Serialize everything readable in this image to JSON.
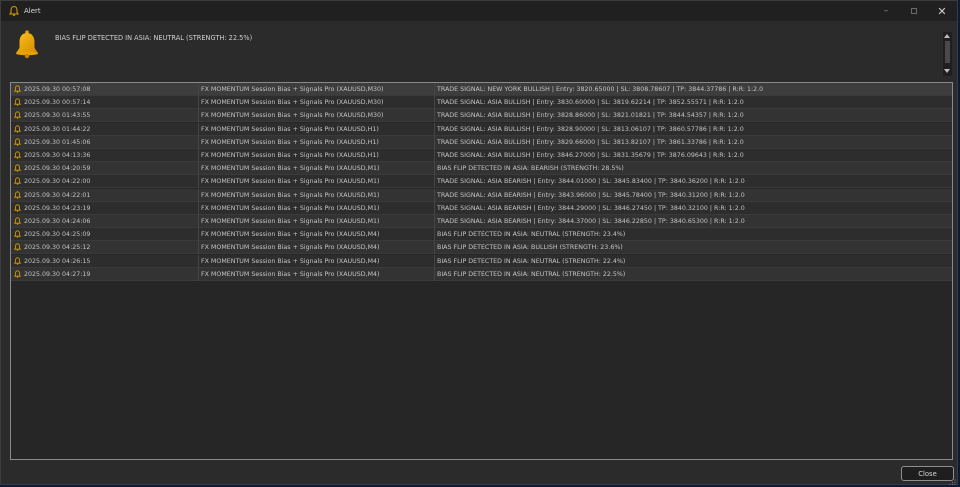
{
  "window": {
    "title": "Alert",
    "minimize_glyph": "–",
    "close_glyph": "✕"
  },
  "current_alert": {
    "icon": "bell-icon",
    "message": "BIAS FLIP DETECTED IN ASIA: NEUTRAL (STRENGTH: 22.5%)"
  },
  "colors": {
    "bell": "#e9a400",
    "row_bell_stroke": "#e0a000",
    "background": "#2b2b2b",
    "titlebar": "#202020"
  },
  "alerts": [
    {
      "time": "2025.09.30 00:57:08",
      "source": "FX MOMENTUM Session Bias + Signals Pro (XAUUSD,M30)",
      "message": "TRADE SIGNAL: NEW YORK BULLISH | Entry: 3820.65000 | SL: 3808.78607 | TP: 3844.37786 | R:R: 1:2.0"
    },
    {
      "time": "2025.09.30 00:57:14",
      "source": "FX MOMENTUM Session Bias + Signals Pro (XAUUSD,M30)",
      "message": "TRADE SIGNAL: ASIA BULLISH | Entry: 3830.60000 | SL: 3819.62214 | TP: 3852.55571 | R:R: 1:2.0"
    },
    {
      "time": "2025.09.30 01:43:55",
      "source": "FX MOMENTUM Session Bias + Signals Pro (XAUUSD,M30)",
      "message": "TRADE SIGNAL: ASIA BULLISH | Entry: 3828.86000 | SL: 3821.01821 | TP: 3844.54357 | R:R: 1:2.0"
    },
    {
      "time": "2025.09.30 01:44:22",
      "source": "FX MOMENTUM Session Bias + Signals Pro (XAUUSD,H1)",
      "message": "TRADE SIGNAL: ASIA BULLISH | Entry: 3828.90000 | SL: 3813.06107 | TP: 3860.57786 | R:R: 1:2.0"
    },
    {
      "time": "2025.09.30 01:45:06",
      "source": "FX MOMENTUM Session Bias + Signals Pro (XAUUSD,H1)",
      "message": "TRADE SIGNAL: ASIA BULLISH | Entry: 3829.66000 | SL: 3813.82107 | TP: 3861.33786 | R:R: 1:2.0"
    },
    {
      "time": "2025.09.30 04:13:36",
      "source": "FX MOMENTUM Session Bias + Signals Pro (XAUUSD,H1)",
      "message": "TRADE SIGNAL: ASIA BULLISH | Entry: 3846.27000 | SL: 3831.35679 | TP: 3876.09643 | R:R: 1:2.0"
    },
    {
      "time": "2025.09.30 04:20:59",
      "source": "FX MOMENTUM Session Bias + Signals Pro (XAUUSD,M1)",
      "message": "BIAS FLIP DETECTED IN ASIA: BEARISH (STRENGTH: 28.5%)"
    },
    {
      "time": "2025.09.30 04:22:00",
      "source": "FX MOMENTUM Session Bias + Signals Pro (XAUUSD,M1)",
      "message": "TRADE SIGNAL: ASIA BEARISH | Entry: 3844.01000 | SL: 3845.83400 | TP: 3840.36200 | R:R: 1:2.0"
    },
    {
      "time": "2025.09.30 04:22:01",
      "source": "FX MOMENTUM Session Bias + Signals Pro (XAUUSD,M1)",
      "message": "TRADE SIGNAL: ASIA BEARISH | Entry: 3843.96000 | SL: 3845.78400 | TP: 3840.31200 | R:R: 1:2.0"
    },
    {
      "time": "2025.09.30 04:23:19",
      "source": "FX MOMENTUM Session Bias + Signals Pro (XAUUSD,M1)",
      "message": "TRADE SIGNAL: ASIA BEARISH | Entry: 3844.29000 | SL: 3846.27450 | TP: 3840.32100 | R:R: 1:2.0"
    },
    {
      "time": "2025.09.30 04:24:06",
      "source": "FX MOMENTUM Session Bias + Signals Pro (XAUUSD,M1)",
      "message": "TRADE SIGNAL: ASIA BEARISH | Entry: 3844.37000 | SL: 3846.22850 | TP: 3840.65300 | R:R: 1:2.0"
    },
    {
      "time": "2025.09.30 04:25:09",
      "source": "FX MOMENTUM Session Bias + Signals Pro (XAUUSD,M4)",
      "message": "BIAS FLIP DETECTED IN ASIA: NEUTRAL (STRENGTH: 23.4%)"
    },
    {
      "time": "2025.09.30 04:25:12",
      "source": "FX MOMENTUM Session Bias + Signals Pro (XAUUSD,M4)",
      "message": "BIAS FLIP DETECTED IN ASIA: BULLISH (STRENGTH: 23.6%)"
    },
    {
      "time": "2025.09.30 04:26:15",
      "source": "FX MOMENTUM Session Bias + Signals Pro (XAUUSD,M4)",
      "message": "BIAS FLIP DETECTED IN ASIA: NEUTRAL (STRENGTH: 22.4%)"
    },
    {
      "time": "2025.09.30 04:27:19",
      "source": "FX MOMENTUM Session Bias + Signals Pro (XAUUSD,M4)",
      "message": "BIAS FLIP DETECTED IN ASIA: NEUTRAL (STRENGTH: 22.5%)"
    }
  ],
  "buttons": {
    "close_label": "Close"
  }
}
